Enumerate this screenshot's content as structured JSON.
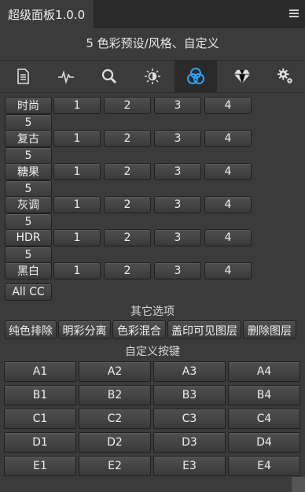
{
  "header": {
    "tab_title": "超级面板1.0.0"
  },
  "subtitle": "5 色彩预设/风格、自定义",
  "toolbar_icons": [
    "document-icon",
    "waveform-icon",
    "magnifier-icon",
    "brightness-icon",
    "color-circles-icon",
    "diamond-icon",
    "gears-icon"
  ],
  "active_icon": "color-circles-icon",
  "presets": [
    {
      "label": "时尚",
      "buttons": [
        "1",
        "2",
        "3",
        "4",
        "5"
      ]
    },
    {
      "label": "复古",
      "buttons": [
        "1",
        "2",
        "3",
        "4",
        "5"
      ]
    },
    {
      "label": "糖果",
      "buttons": [
        "1",
        "2",
        "3",
        "4",
        "5"
      ]
    },
    {
      "label": "灰调",
      "buttons": [
        "1",
        "2",
        "3",
        "4",
        "5"
      ]
    },
    {
      "label": "HDR",
      "buttons": [
        "1",
        "2",
        "3",
        "4",
        "5"
      ]
    },
    {
      "label": "黑白",
      "buttons": [
        "1",
        "2",
        "3",
        "4"
      ]
    }
  ],
  "all_cc": "All CC",
  "other_options": {
    "title": "其它选项",
    "buttons": [
      "纯色排除",
      "明彩分离",
      "色彩混合",
      "盖印可见图层",
      "删除图层"
    ]
  },
  "custom_keys": {
    "title": "自定义按键",
    "rows": [
      [
        "A1",
        "A2",
        "A3",
        "A4"
      ],
      [
        "B1",
        "B2",
        "B3",
        "B4"
      ],
      [
        "C1",
        "C2",
        "C3",
        "C4"
      ],
      [
        "D1",
        "D2",
        "D3",
        "D4"
      ],
      [
        "E1",
        "E2",
        "E3",
        "E4"
      ]
    ]
  },
  "colors": {
    "panel_bg": "#3b3b3b",
    "header_bg": "#2a2a2a",
    "accent_blue": "#2ea3f2"
  }
}
